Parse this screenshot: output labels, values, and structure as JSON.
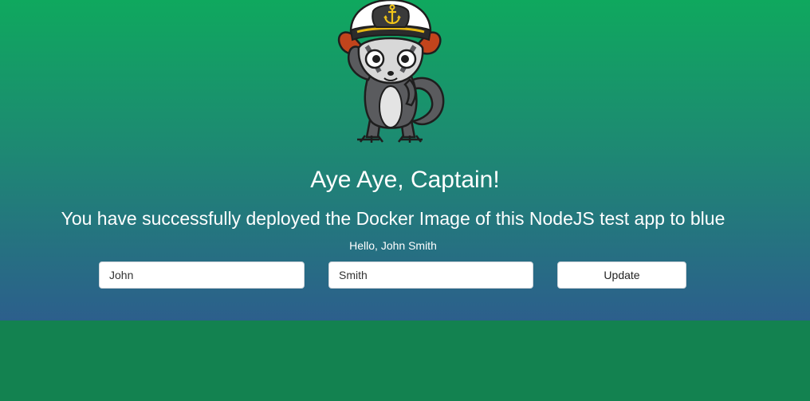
{
  "header": {
    "title": "Aye Aye, Captain!",
    "subtitle": "You have successfully deployed the Docker Image of this NodeJS test app to blue"
  },
  "greeting": {
    "prefix": "Hello, ",
    "first_name": "John",
    "last_name": "Smith"
  },
  "form": {
    "first_name_value": "John",
    "last_name_value": "Smith",
    "update_label": "Update"
  },
  "colors": {
    "gradient_top": "#0fa85e",
    "gradient_bottom": "#2c5f8c",
    "page_background": "#138250",
    "text": "#ffffff"
  },
  "icons": {
    "mascot": "lemur-captain-mascot",
    "hat_badge": "anchor-icon"
  }
}
